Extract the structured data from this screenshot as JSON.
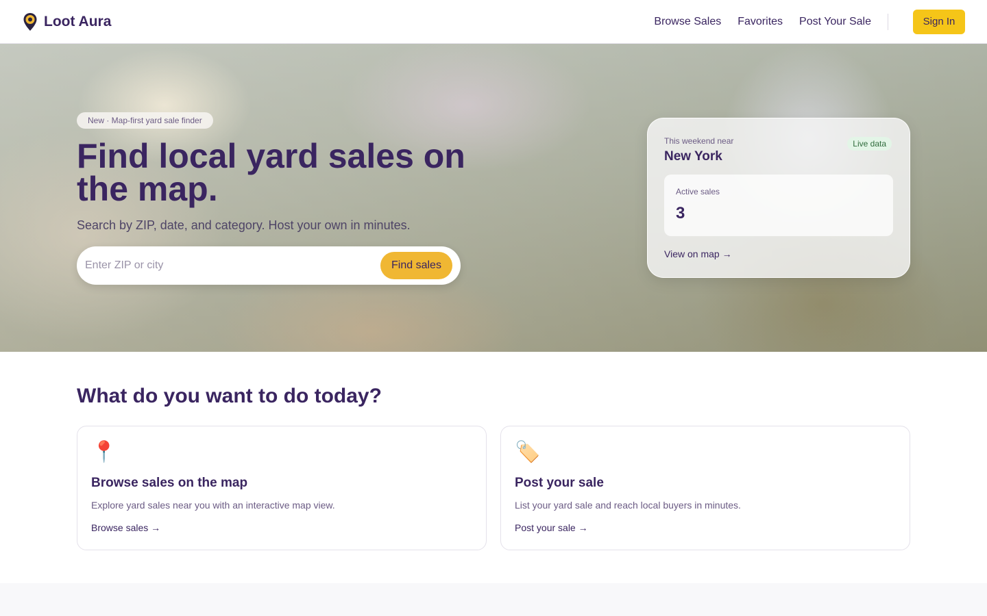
{
  "brand": {
    "name": "Loot Aura",
    "accent": "#f5c518",
    "text_color": "#3a2560"
  },
  "nav": {
    "links": [
      "Browse Sales",
      "Favorites",
      "Post Your Sale"
    ],
    "sign_in": "Sign In"
  },
  "hero": {
    "badge": "New · Map-first yard sale finder",
    "title": "Find local yard sales on the map.",
    "subtitle": "Search by ZIP, date, and category. Host your own in minutes.",
    "search_placeholder": "Enter ZIP or city",
    "search_button": "Find sales"
  },
  "stats": {
    "near_label": "This weekend near",
    "city": "New York",
    "live_badge": "Live data",
    "active_label": "Active sales",
    "active_value": "3",
    "view_link": "View on map →"
  },
  "section": {
    "title": "What do you want to do today?",
    "cards": [
      {
        "icon": "📍",
        "icon_name": "map-pin-icon",
        "title": "Browse sales on the map",
        "description": "Explore yard sales near you with an interactive map view.",
        "link": "Browse sales →"
      },
      {
        "icon": "🏷️",
        "icon_name": "price-tag-icon",
        "title": "Post your sale",
        "description": "List your yard sale and reach local buyers in minutes.",
        "link": "Post your sale →"
      }
    ]
  }
}
